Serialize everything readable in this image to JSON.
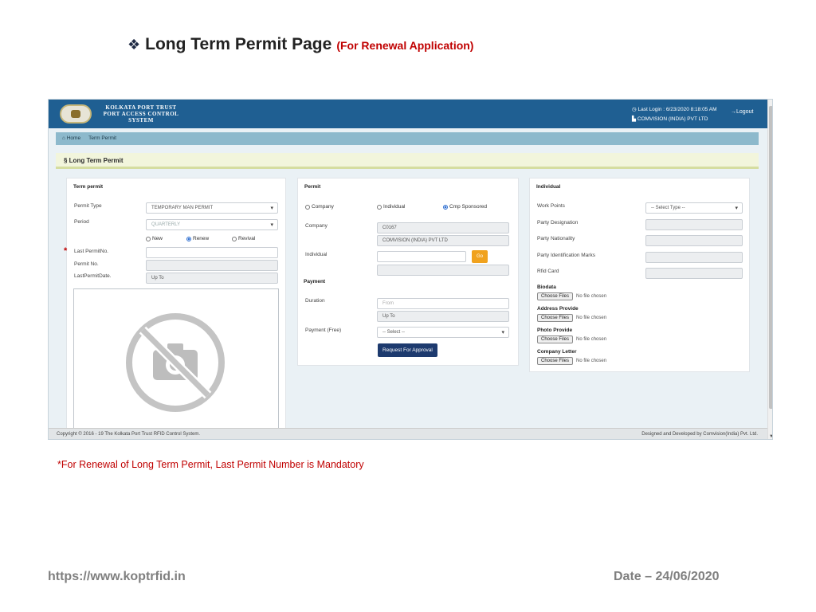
{
  "slide": {
    "title": "Long Term Permit Page",
    "subtitle": "(For Renewal Application)",
    "note": "*For Renewal of Long Term Permit, Last Permit Number is Mandatory",
    "url": "https://www.koptrfid.in",
    "date": "Date – 24/06/2020"
  },
  "app": {
    "brand_line1": "KOLKATA PORT TRUST",
    "brand_line2": "PORT ACCESS CONTROL",
    "brand_line3": "SYSTEM",
    "last_login": "◷ Last Login : 6/23/2020 8:18:05 AM",
    "company": "COMVISION (INDIA) PVT LTD",
    "logout": "→Logout",
    "breadcrumb": [
      "Home",
      "Term Permit"
    ],
    "page_title": "Long Term Permit"
  },
  "term_permit": {
    "title": "Term permit",
    "permit_type_label": "Permit Type",
    "permit_type_value": "TEMPORARY MAN PERMIT",
    "period_label": "Period",
    "period_value": "QUARTERLY",
    "radio_new": "New",
    "radio_renew": "Renew",
    "radio_revival": "Revival",
    "last_permit_no_label": "Last PermitNo.",
    "permit_no_label": "Permit No.",
    "last_permit_date_label": "LastPermitDate.",
    "last_permit_date_value": "Up To"
  },
  "permit": {
    "title": "Permit",
    "radio_company": "Company",
    "radio_individual": "Individual",
    "radio_cmp": "Cmp Sponsored",
    "company_label": "Company",
    "company_code": "C0167",
    "company_name": "COMVISION (INDIA) PVT LTD",
    "individual_label": "Individual",
    "go_label": "Go",
    "payment_title": "Payment",
    "duration_label": "Duration",
    "duration_from": "From",
    "duration_upto": "Up To",
    "payment_label": "Payment (Free)",
    "payment_value": "-- Select --",
    "approve_label": "Request For Approval"
  },
  "individual": {
    "title": "Individual",
    "work_points_label": "Work Points",
    "work_points_value": "-- Select Type --",
    "designation_label": "Party Designation",
    "nationality_label": "Party Nationality",
    "id_marks_label": "Party Identification Marks",
    "rfid_label": "Rfid Card",
    "biodata_title": "Biodata",
    "address_title": "Address Provide",
    "photo_title": "Photo Provide",
    "letter_title": "Company Letter",
    "choose_label": "Choose Files",
    "no_file": "No file chosen"
  },
  "footer": {
    "copyright": "Copyright © 2016 - 19 The Kolkata Port Trust RFID Control System.",
    "designed": "Designed and Developed by Comvision(India) Pvt. Ltd."
  }
}
